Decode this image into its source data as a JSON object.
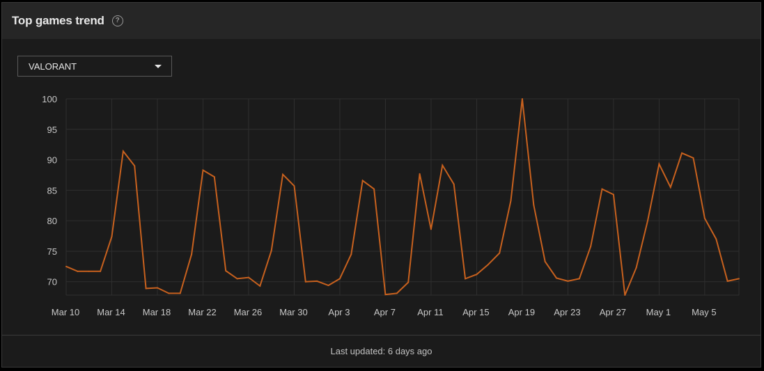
{
  "header": {
    "title": "Top games trend",
    "help_icon": "question-circle-icon"
  },
  "game_select": {
    "value": "VALORANT",
    "icon": "caret-down-icon"
  },
  "footer": {
    "last_updated": "Last updated: 6 days ago"
  },
  "colors": {
    "line": "#c8611e",
    "grid": "#2f2f2f",
    "axis_text": "#c8c8c8"
  },
  "chart_data": {
    "type": "line",
    "title": "",
    "xlabel": "",
    "ylabel": "",
    "ylim": [
      67.8,
      100
    ],
    "yticks": [
      70,
      75,
      80,
      85,
      90,
      95,
      100
    ],
    "grid": true,
    "x_tick_labels": [
      "Mar 10",
      "Mar 14",
      "Mar 18",
      "Mar 22",
      "Mar 26",
      "Mar 30",
      "Apr 3",
      "Apr 7",
      "Apr 11",
      "Apr 15",
      "Apr 19",
      "Apr 23",
      "Apr 27",
      "May 1",
      "May 5"
    ],
    "x": [
      "Mar 10",
      "Mar 11",
      "Mar 12",
      "Mar 13",
      "Mar 14",
      "Mar 15",
      "Mar 16",
      "Mar 17",
      "Mar 18",
      "Mar 19",
      "Mar 20",
      "Mar 21",
      "Mar 22",
      "Mar 23",
      "Mar 24",
      "Mar 25",
      "Mar 26",
      "Mar 27",
      "Mar 28",
      "Mar 29",
      "Mar 30",
      "Mar 31",
      "Apr 1",
      "Apr 2",
      "Apr 3",
      "Apr 4",
      "Apr 5",
      "Apr 6",
      "Apr 7",
      "Apr 8",
      "Apr 9",
      "Apr 10",
      "Apr 11",
      "Apr 12",
      "Apr 13",
      "Apr 14",
      "Apr 15",
      "Apr 16",
      "Apr 17",
      "Apr 18",
      "Apr 19",
      "Apr 20",
      "Apr 21",
      "Apr 22",
      "Apr 23",
      "Apr 24",
      "Apr 25",
      "Apr 26",
      "Apr 27",
      "Apr 28",
      "Apr 29",
      "Apr 30",
      "May 1",
      "May 2",
      "May 3",
      "May 4",
      "May 5",
      "May 6",
      "May 7",
      "May 8"
    ],
    "series": [
      {
        "values": [
          72.5,
          71.7,
          71.7,
          71.7,
          77.4,
          91.4,
          89.0,
          68.9,
          69.0,
          68.1,
          68.1,
          74.5,
          88.3,
          87.2,
          71.8,
          70.5,
          70.7,
          69.3,
          75.1,
          87.6,
          85.7,
          70.0,
          70.1,
          69.4,
          70.5,
          74.5,
          86.6,
          85.2,
          67.9,
          68.1,
          69.9,
          87.7,
          78.6,
          89.1,
          86.0,
          70.5,
          71.2,
          72.8,
          74.7,
          83.3,
          100.0,
          82.6,
          73.3,
          70.6,
          70.1,
          70.5,
          75.8,
          85.2,
          84.3,
          67.8,
          72.3,
          80.0,
          89.3,
          85.5,
          91.1,
          90.3,
          80.4,
          77.0,
          70.1,
          70.5
        ]
      }
    ]
  }
}
